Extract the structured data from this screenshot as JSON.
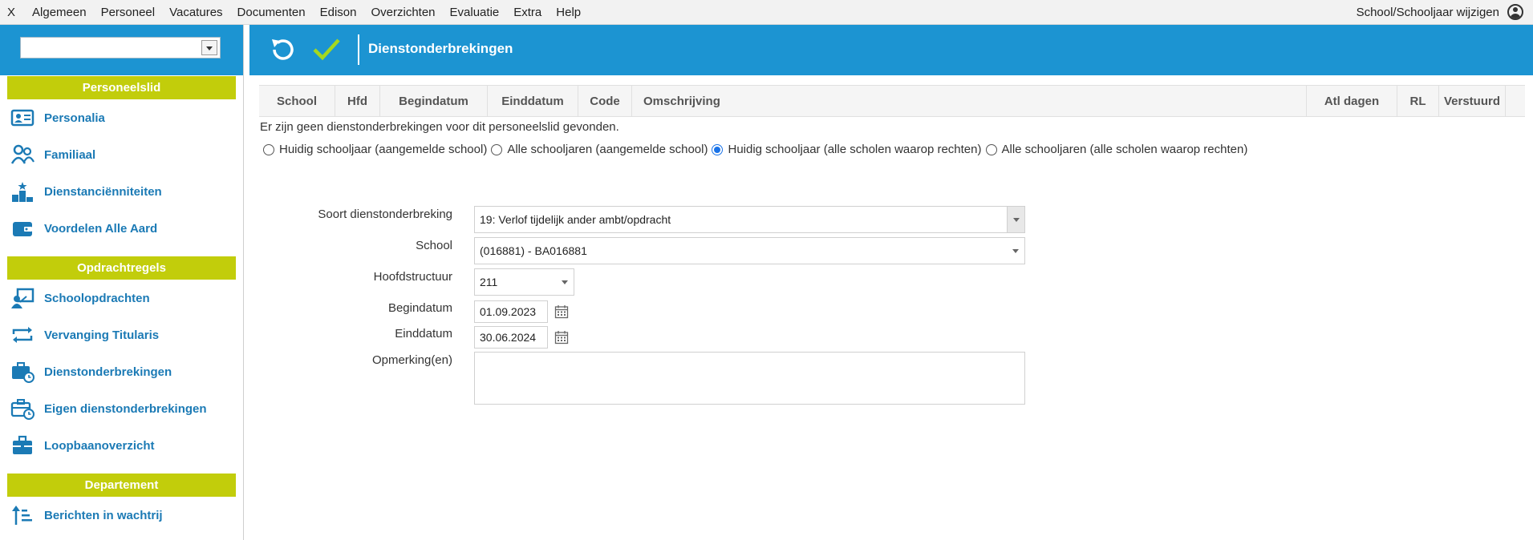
{
  "menubar": {
    "items": [
      "X",
      "Algemeen",
      "Personeel",
      "Vacatures",
      "Documenten",
      "Edison",
      "Overzichten",
      "Evaluatie",
      "Extra",
      "Help"
    ],
    "right_label": "School/Schooljaar wijzigen",
    "user_icon": "user-circle-icon"
  },
  "sidebar": {
    "combo_value": "",
    "sections": [
      {
        "title": "Personeelslid",
        "items": [
          {
            "label": "Personalia",
            "icon": "id-card-icon"
          },
          {
            "label": "Familiaal",
            "icon": "family-icon"
          },
          {
            "label": "Dienstanciënniteiten",
            "icon": "podium-icon"
          },
          {
            "label": "Voordelen Alle Aard",
            "icon": "wallet-icon"
          }
        ]
      },
      {
        "title": "Opdrachtregels",
        "items": [
          {
            "label": "Schoolopdrachten",
            "icon": "teacher-board-icon"
          },
          {
            "label": "Vervanging Titularis",
            "icon": "swap-arrows-icon"
          },
          {
            "label": "Dienstonderbrekingen",
            "icon": "briefcase-clock-icon"
          },
          {
            "label": "Eigen dienstonderbrekingen",
            "icon": "briefcase-clock-outline-icon"
          },
          {
            "label": "Loopbaanoverzicht",
            "icon": "briefcase-icon"
          }
        ]
      },
      {
        "title": "Departement",
        "items": [
          {
            "label": "Berichten in wachtrij",
            "icon": "sort-queue-icon"
          }
        ]
      }
    ]
  },
  "header": {
    "title": "Dienstonderbrekingen",
    "undo_icon": "undo-icon",
    "save_icon": "checkmark-icon"
  },
  "grid": {
    "columns": [
      "School",
      "Hfd",
      "Begindatum",
      "Einddatum",
      "Code",
      "Omschrijving",
      "Atl dagen",
      "RL",
      "Verstuurd"
    ],
    "empty_message": "Er zijn geen dienstonderbrekingen voor dit personeelslid gevonden."
  },
  "filter": {
    "options": [
      {
        "label": "Huidig schooljaar (aangemelde school)",
        "checked": false
      },
      {
        "label": "Alle schooljaren (aangemelde school)",
        "checked": false
      },
      {
        "label": "Huidig schooljaar (alle scholen waarop rechten)",
        "checked": true
      },
      {
        "label": "Alle schooljaren (alle scholen waarop rechten)",
        "checked": false
      }
    ]
  },
  "form": {
    "soort_label": "Soort dienstonderbreking",
    "soort_value": "19: Verlof tijdelijk ander ambt/opdracht",
    "school_label": "School",
    "school_value": "(016881) - BA016881",
    "hoofd_label": "Hoofdstructuur",
    "hoofd_value": "211",
    "begin_label": "Begindatum",
    "begin_value": "01.09.2023",
    "eind_label": "Einddatum",
    "eind_value": "30.06.2024",
    "opm_label": "Opmerking(en)",
    "opm_value": ""
  },
  "colors": {
    "brand_blue": "#1c94d2",
    "section_green": "#c2cd0b",
    "nav_text": "#1b7ab5",
    "check_green": "#a6d81e"
  }
}
